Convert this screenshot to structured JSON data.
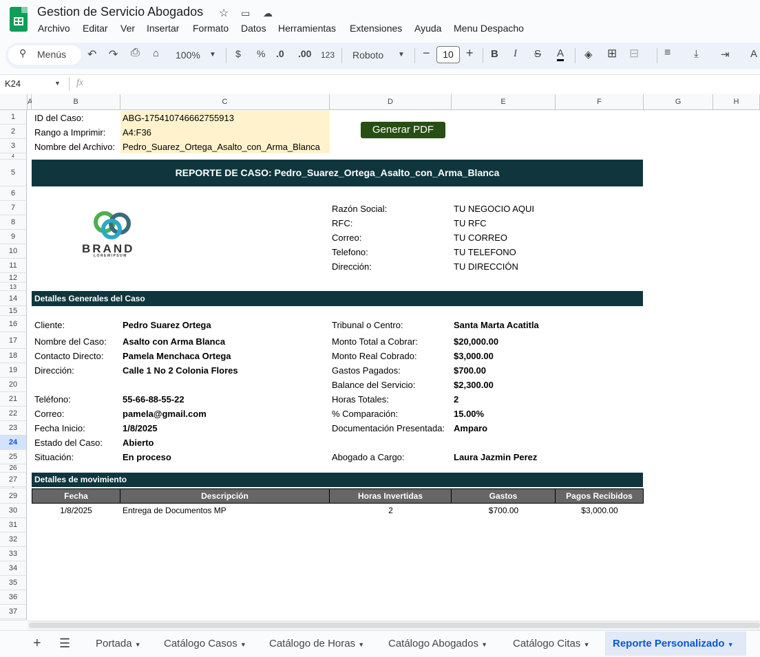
{
  "app": {
    "title": "Gestion de Servicio Abogados",
    "menus": [
      "Archivo",
      "Editar",
      "Ver",
      "Insertar",
      "Formato",
      "Datos",
      "Herramientas",
      "Extensiones",
      "Ayuda",
      "Menu Despacho"
    ]
  },
  "toolbar": {
    "search": "Menús",
    "zoom": "100%",
    "currency": "$",
    "percent": "%",
    "dec_less": ".0",
    "dec_more": ".00",
    "format_num": "123",
    "font": "Roboto",
    "font_size": "10"
  },
  "formula": {
    "namebox": "K24",
    "fx": "fx"
  },
  "columns": [
    "A",
    "B",
    "C",
    "D",
    "E",
    "F",
    "G",
    "H"
  ],
  "rows": [
    "1",
    "2",
    "3",
    "4",
    "5",
    "6",
    "7",
    "8",
    "9",
    "10",
    "11",
    "12",
    "13",
    "14",
    "15",
    "16",
    "17",
    "18",
    "19",
    "20",
    "21",
    "22",
    "23",
    "24",
    "25",
    "26",
    "27",
    "28",
    "29",
    "30",
    "31",
    "32",
    "33",
    "34",
    "35",
    "36",
    "37"
  ],
  "header_params": [
    {
      "label": "ID del Caso:",
      "value": "ABG-175410746662755913"
    },
    {
      "label": "Rango a Imprimir:",
      "value": "A4:F36"
    },
    {
      "label": "Nombre del Archivo:",
      "value": "Pedro_Suarez_Ortega_Asalto_con_Arma_Blanca"
    }
  ],
  "generate_button": "Generar PDF",
  "report_title": "REPORTE DE CASO: Pedro_Suarez_Ortega_Asalto_con_Arma_Blanca",
  "brand": {
    "name": "BRAND",
    "tagline": "LOREMIPSUM"
  },
  "business": [
    {
      "label": "Razón Social:",
      "value": "TU NEGOCIO AQUI"
    },
    {
      "label": "RFC:",
      "value": "TU RFC"
    },
    {
      "label": "Correo:",
      "value": "TU CORREO"
    },
    {
      "label": "Telefono:",
      "value": "TU TELEFONO"
    },
    {
      "label": "Dirección:",
      "value": "TU DIRECCIÓN"
    }
  ],
  "section_general": "Detalles Generales del Caso",
  "general_left": [
    {
      "label": "Cliente:",
      "value": "Pedro Suarez Ortega"
    },
    {
      "label": "Nombre del Caso:",
      "value": "Asalto con Arma Blanca"
    },
    {
      "label": "Contacto Directo:",
      "value": "Pamela Menchaca Ortega"
    },
    {
      "label": "Dirección:",
      "value": "Calle 1 No 2 Colonia Flores"
    },
    {
      "label": "Teléfono:",
      "value": "55-66-88-55-22"
    },
    {
      "label": "Correo:",
      "value": "pamela@gmail.com"
    },
    {
      "label": "Fecha Inicio:",
      "value": "1/8/2025"
    },
    {
      "label": "Estado del Caso:",
      "value": "Abierto"
    },
    {
      "label": "Situación:",
      "value": "En proceso"
    }
  ],
  "general_right": [
    {
      "label": "Tribunal o Centro:",
      "value": "Santa Marta Acatitla"
    },
    {
      "label": "Monto Total a Cobrar:",
      "value": "$20,000.00"
    },
    {
      "label": "Monto Real Cobrado:",
      "value": "$3,000.00"
    },
    {
      "label": "Gastos Pagados:",
      "value": "$700.00"
    },
    {
      "label": "Balance del  Servicio:",
      "value": "$2,300.00"
    },
    {
      "label": "Horas Totales:",
      "value": "2"
    },
    {
      "label": "% Comparación:",
      "value": "15.00%"
    },
    {
      "label": "Documentación Presentada:",
      "value": "Amparo"
    },
    {
      "label": "Abogado a Cargo:",
      "value": "Laura Jazmin Perez"
    }
  ],
  "section_movements": "Detalles de movimiento",
  "movements": {
    "headers": [
      "Fecha",
      "Descripción",
      "Horas Invertidas",
      "Gastos",
      "Pagos Recibidos"
    ],
    "rows": [
      [
        "1/8/2025",
        "Entrega de Documentos MP",
        "2",
        "$700.00",
        "$3,000.00"
      ]
    ]
  },
  "sheets": [
    "Portada",
    "Catálogo Casos",
    "Catálogo de Horas",
    "Catálogo Abogados",
    "Catálogo Citas",
    "Reporte Personalizado"
  ]
}
